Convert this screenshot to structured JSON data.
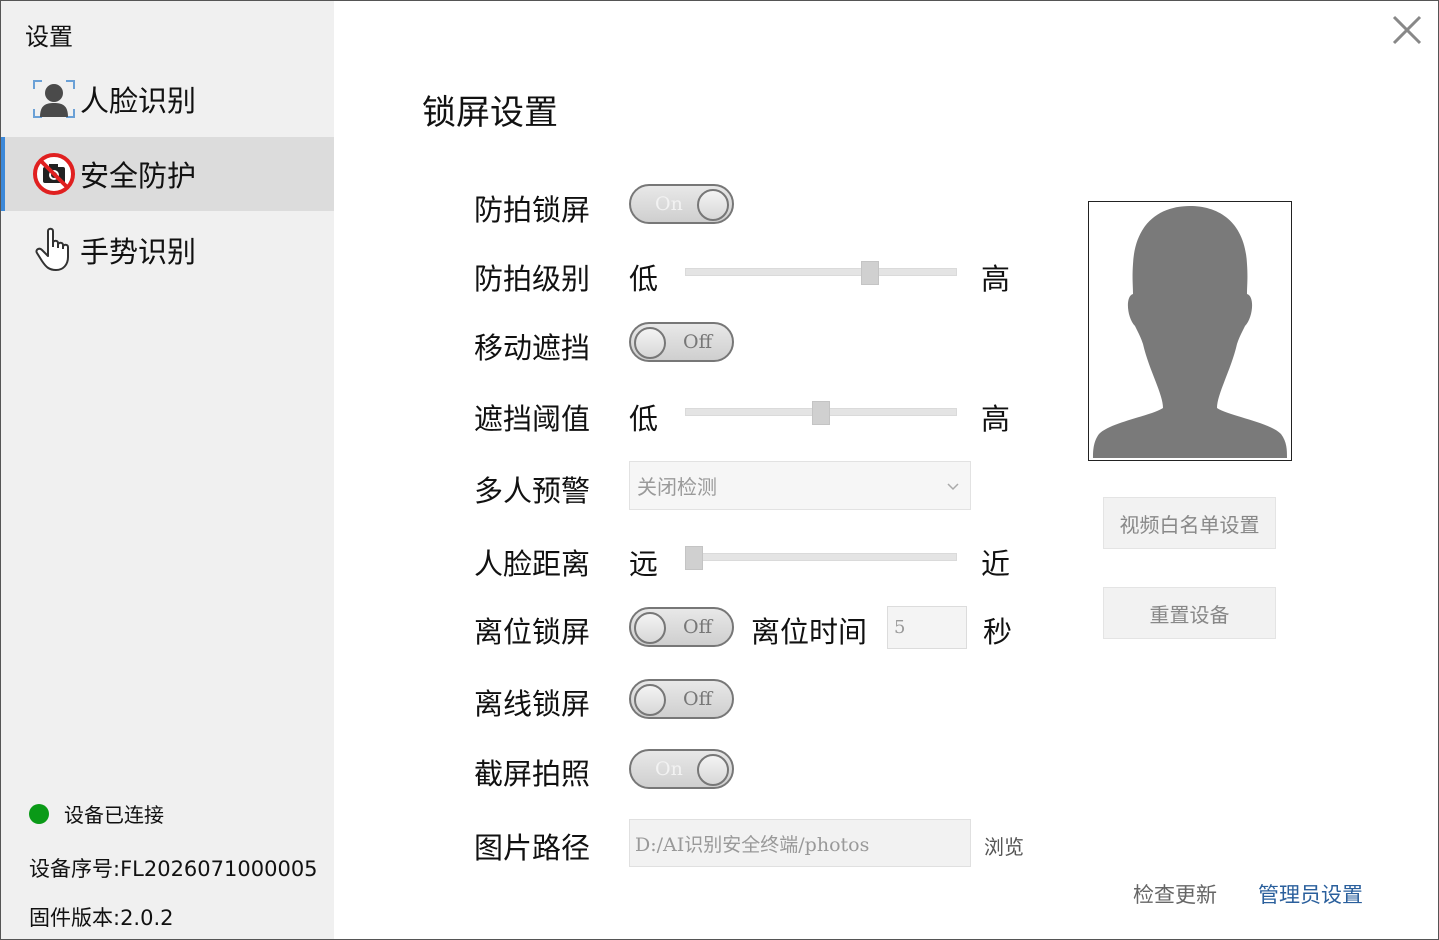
{
  "window": {
    "title": "设置"
  },
  "sidebar": {
    "items": [
      {
        "label": "人脸识别",
        "icon": "face-id-icon",
        "active": false
      },
      {
        "label": "安全防护",
        "icon": "no-camera-icon",
        "active": true
      },
      {
        "label": "手势识别",
        "icon": "hand-pointer-icon",
        "active": false
      }
    ],
    "status": {
      "text": "设备已连接",
      "color": "#0a9a17"
    },
    "serial": "设备序号:FL2026071000005",
    "firmware": "固件版本:2.0.2"
  },
  "main": {
    "title": "锁屏设置",
    "anti_photo_lock": {
      "label": "防拍锁屏",
      "state": "On"
    },
    "anti_photo_level": {
      "label": "防拍级别",
      "low": "低",
      "high": "高",
      "value": 0.68
    },
    "motion_block": {
      "label": "移动遮挡",
      "state": "Off"
    },
    "block_threshold": {
      "label": "遮挡阈值",
      "low": "低",
      "high": "高",
      "value": 0.5
    },
    "multi_person": {
      "label": "多人预警",
      "selected": "关闭检测"
    },
    "face_distance": {
      "label": "人脸距离",
      "low": "远",
      "high": "近",
      "value": 0.03
    },
    "away_lock": {
      "label": "离位锁屏",
      "state": "Off",
      "time_label": "离位时间",
      "time_value": "5",
      "unit": "秒"
    },
    "offline_lock": {
      "label": "离线锁屏",
      "state": "Off"
    },
    "screenshot_photo": {
      "label": "截屏拍照",
      "state": "On"
    },
    "image_path": {
      "label": "图片路径",
      "value": "D:/AI识别安全终端/photos",
      "browse": "浏览"
    },
    "whitelist_button": "视频白名单设置",
    "reset_button": "重置设备",
    "check_update": "检查更新",
    "admin_settings": "管理员设置"
  },
  "colors": {
    "accent": "#3c88d8",
    "link": "#2a5f9c"
  }
}
